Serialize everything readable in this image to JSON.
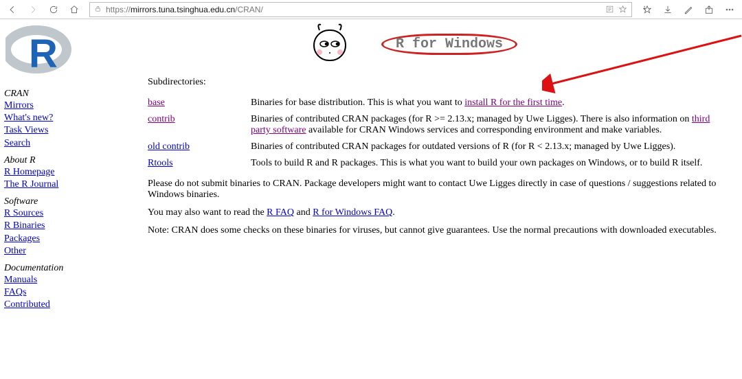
{
  "browser": {
    "url_prefix": "https://",
    "url_domain": "mirrors.tuna.tsinghua.edu.cn",
    "url_path": "/CRAN/"
  },
  "header": {
    "r_for_windows": "R for Windows"
  },
  "sidebar": {
    "groups": [
      {
        "label": "CRAN",
        "items": [
          "Mirrors",
          "What's new?",
          "Task Views",
          "Search"
        ]
      },
      {
        "label": "About R",
        "items": [
          "R Homepage",
          "The R Journal"
        ]
      },
      {
        "label": "Software",
        "items": [
          "R Sources",
          "R Binaries",
          "Packages",
          "Other"
        ]
      },
      {
        "label": "Documentation",
        "items": [
          "Manuals",
          "FAQs",
          "Contributed"
        ]
      }
    ]
  },
  "main": {
    "subdirs_label": "Subdirectories:",
    "rows": [
      {
        "name": "base",
        "desc_pre": "Binaries for base distribution. This is what you want to ",
        "desc_link": "install R for the first time",
        "desc_post": "."
      },
      {
        "name": "contrib",
        "desc_pre": "Binaries of contributed CRAN packages (for R >= 2.13.x; managed by Uwe Ligges). There is also information on ",
        "desc_link": "third party software",
        "desc_post": " available for CRAN Windows services and corresponding environment and make variables."
      },
      {
        "name": "old contrib",
        "desc_pre": "Binaries of contributed CRAN packages for outdated versions of R (for R < 2.13.x; managed by Uwe Ligges).",
        "desc_link": "",
        "desc_post": ""
      },
      {
        "name": "Rtools",
        "desc_pre": "Tools to build R and R packages. This is what you want to build your own packages on Windows, or to build R itself.",
        "desc_link": "",
        "desc_post": ""
      }
    ],
    "p1": "Please do not submit binaries to CRAN. Package developers might want to contact Uwe Ligges directly in case of questions / suggestions related to Windows binaries.",
    "p2_pre": "You may also want to read the ",
    "p2_link1": "R FAQ",
    "p2_mid": " and ",
    "p2_link2": "R for Windows FAQ",
    "p2_post": ".",
    "p3": "Note: CRAN does some checks on these binaries for viruses, but cannot give guarantees. Use the normal precautions with downloaded executables."
  }
}
